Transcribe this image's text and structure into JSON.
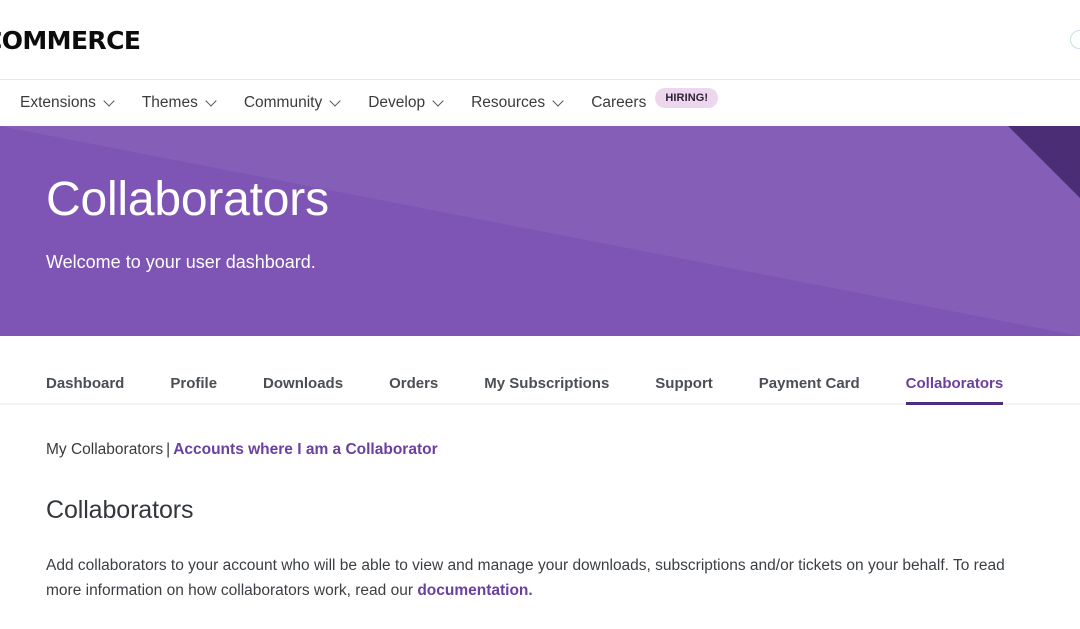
{
  "header": {
    "logo_text": "COMMERCE",
    "right_icon": "search-icon"
  },
  "main_nav": {
    "items": [
      {
        "label": "Extensions",
        "has_caret": true
      },
      {
        "label": "Themes",
        "has_caret": true
      },
      {
        "label": "Community",
        "has_caret": true
      },
      {
        "label": "Develop",
        "has_caret": true
      },
      {
        "label": "Resources",
        "has_caret": true
      },
      {
        "label": "Careers",
        "has_caret": false,
        "badge": "HIRING!"
      }
    ]
  },
  "hero": {
    "title": "Collaborators",
    "subtitle": "Welcome to your user dashboard.",
    "bg_color": "#7e55b4",
    "accent_dark_color": "#4a2d75"
  },
  "tabs": {
    "items": [
      {
        "label": "Dashboard",
        "active": false
      },
      {
        "label": "Profile",
        "active": false
      },
      {
        "label": "Downloads",
        "active": false
      },
      {
        "label": "Orders",
        "active": false
      },
      {
        "label": "My Subscriptions",
        "active": false
      },
      {
        "label": "Support",
        "active": false
      },
      {
        "label": "Payment Card",
        "active": false
      },
      {
        "label": "Collaborators",
        "active": true
      }
    ],
    "active_color": "#6b3fa0",
    "underline_color": "#4c2e7c"
  },
  "content": {
    "sub_nav": {
      "current": "My Collaborators",
      "separator": "|",
      "link": "Accounts where I am a Collaborator"
    },
    "section_title": "Collaborators",
    "paragraph_before_link": "Add collaborators to your account who will be able to view and manage your downloads, subscriptions and/or tickets on your behalf. To read more information on how collaborators work, read our ",
    "paragraph_link": "documentation.",
    "link_color": "#6b3fa0"
  }
}
